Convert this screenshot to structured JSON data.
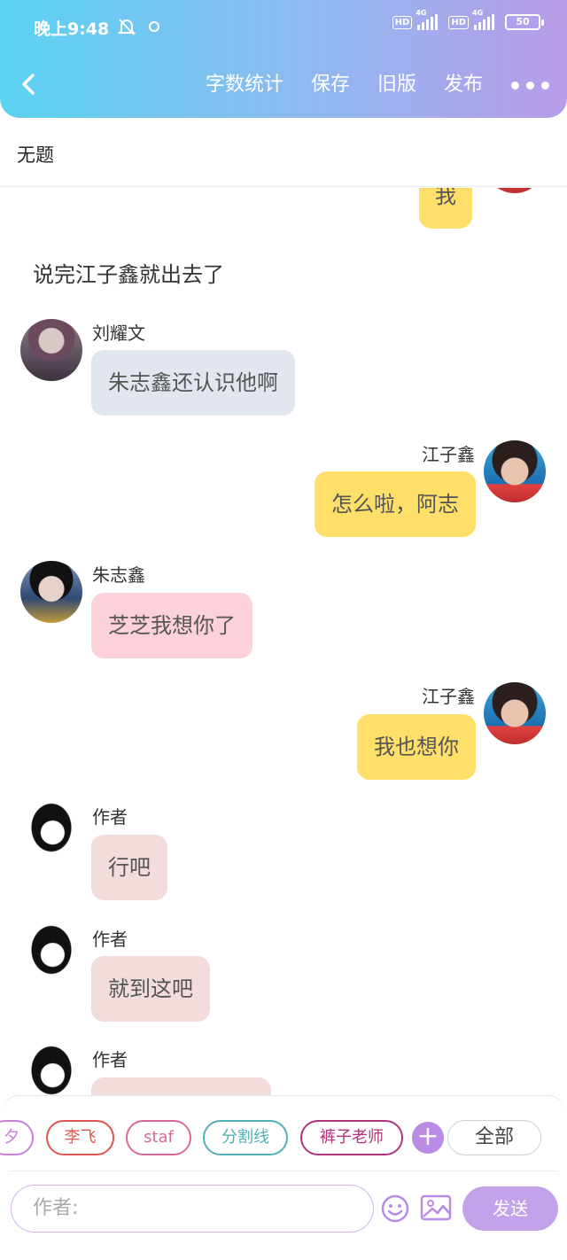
{
  "status_bar": {
    "time": "晚上9:48",
    "network_1": "4G",
    "network_2": "4G",
    "hd_1": "HD",
    "hd_2": "HD",
    "battery": "50"
  },
  "header": {
    "nav": [
      "字数统计",
      "保存",
      "旧版",
      "发布"
    ]
  },
  "document": {
    "title": "无题"
  },
  "chat": {
    "top_partial_bubble": "我",
    "narration": "说完江子鑫就出去了",
    "messages": [
      {
        "name": "刘耀文",
        "text": "朱志鑫还认识他啊",
        "side": "left",
        "color": "#e2e6ef"
      },
      {
        "name": "江子鑫",
        "text": "怎么啦，阿志",
        "side": "right",
        "color": "#fddf6a"
      },
      {
        "name": "朱志鑫",
        "text": "芝芝我想你了",
        "side": "left",
        "color": "#fcd1d9"
      },
      {
        "name": "江子鑫",
        "text": "我也想你",
        "side": "right",
        "color": "#fddf6a"
      },
      {
        "name": "作者",
        "text": "行吧",
        "side": "left",
        "color": "#f2dcdc"
      },
      {
        "name": "作者",
        "text": "就到这吧",
        "side": "left",
        "color": "#f2dcdc"
      },
      {
        "name": "作者",
        "text": "",
        "side": "left",
        "color": "#f2dcdc"
      }
    ]
  },
  "role_chips": [
    {
      "label": "夕",
      "color": "#c77fd6"
    },
    {
      "label": "李飞",
      "color": "#e0564f"
    },
    {
      "label": "staf",
      "color": "#d86a9a"
    },
    {
      "label": "分割线",
      "color": "#4fb0b8"
    },
    {
      "label": "裤子老师",
      "color": "#b0337a"
    }
  ],
  "all_button": "全部",
  "input": {
    "placeholder": "作者:"
  },
  "send_button": "发送",
  "colors": {
    "header_gradient_start": "#5ad2f2",
    "header_gradient_end": "#b99be9",
    "accent": "#b98ae6"
  }
}
